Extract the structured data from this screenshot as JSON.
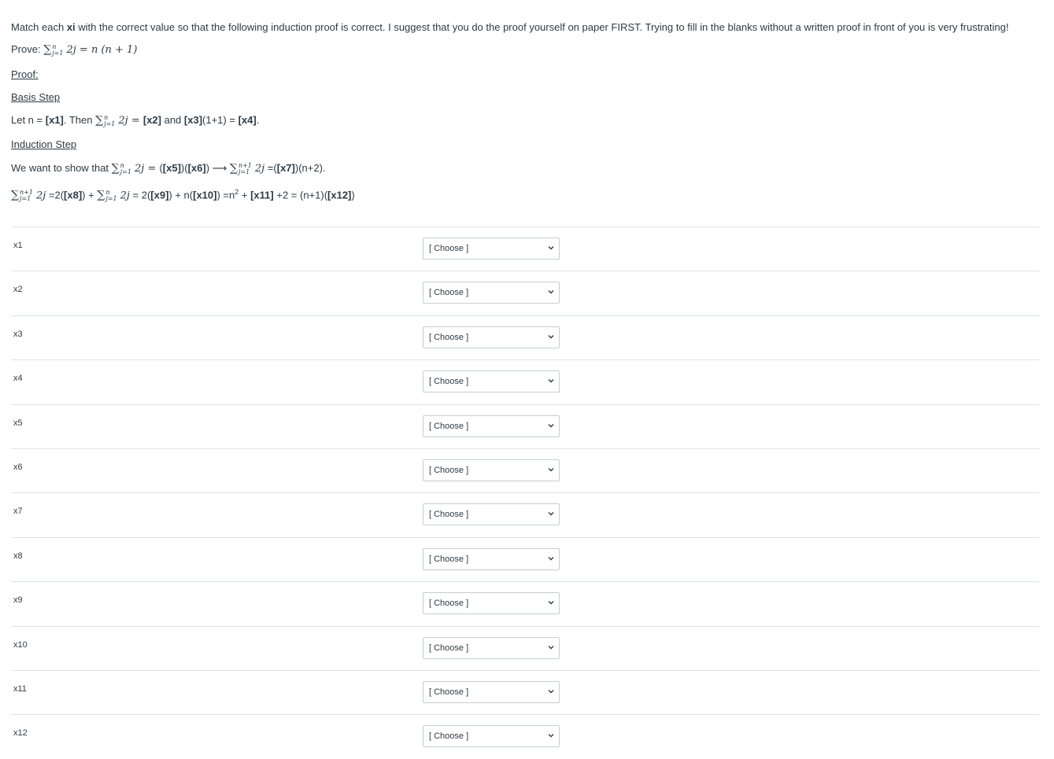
{
  "instructions": {
    "pre": "Match each ",
    "bold": "xi",
    "post": " with the correct value so that the following induction proof is correct.  I suggest that you do the proof yourself on paper FIRST.  Trying to fill in the blanks without a written proof in front of you is very frustrating!"
  },
  "prove": {
    "label": "Prove: ",
    "sigma": "∑",
    "upper": "n",
    "lower": "j=1",
    "term": "2j",
    "eq": " = ",
    "rhs": "n (n + 1)"
  },
  "proof_heading": "Proof:",
  "basis": {
    "heading": "Basis Step",
    "pre": "Let n = ",
    "x1": "[x1]",
    "then": ".  Then ",
    "sigma": "∑",
    "upper": "n",
    "lower": "j=1",
    "term": "2j",
    "eq": " = ",
    "x2": "[x2]",
    "and": " and ",
    "x3": "[x3]",
    "mid": "(1+1) = ",
    "x4": "[x4]",
    "end": "."
  },
  "induction": {
    "heading": "Induction Step",
    "want_pre": "We want to show that ",
    "sigma": "∑",
    "n": "n",
    "n1": "n+1",
    "lower": "j=1",
    "term": "2j",
    "eq": " = ",
    "p1": "(",
    "x5": "[x5]",
    "p2": ")(",
    "x6": "[x6]",
    "p3": ")",
    "arrow": " ⟶ ",
    "eq2": " =(",
    "x7": "[x7]",
    "tail1": ")(n+2).",
    "l2_eq": " =2(",
    "x8": "[x8]",
    "l2_plus": ") + ",
    "l2_eq2": " = 2(",
    "x9": "[x9]",
    "l2_n": ") + n(",
    "x10": "[x10]",
    "l2_sq": ") =n",
    "sup2": "2",
    "l2_plus2": " + ",
    "x11": "[x11]",
    "l2_plus3": " +2 = (n+1)(",
    "x12": "[x12]",
    "l2_end": ")"
  },
  "rows": [
    {
      "label": "x1",
      "value": "[ Choose ]"
    },
    {
      "label": "x2",
      "value": "[ Choose ]"
    },
    {
      "label": "x3",
      "value": "[ Choose ]"
    },
    {
      "label": "x4",
      "value": "[ Choose ]"
    },
    {
      "label": "x5",
      "value": "[ Choose ]"
    },
    {
      "label": "x6",
      "value": "[ Choose ]"
    },
    {
      "label": "x7",
      "value": "[ Choose ]"
    },
    {
      "label": "x8",
      "value": "[ Choose ]"
    },
    {
      "label": "x9",
      "value": "[ Choose ]"
    },
    {
      "label": "x10",
      "value": "[ Choose ]"
    },
    {
      "label": "x11",
      "value": "[ Choose ]"
    },
    {
      "label": "x12",
      "value": "[ Choose ]"
    }
  ],
  "icons": {
    "dropdown": "chevron-down-icon"
  }
}
